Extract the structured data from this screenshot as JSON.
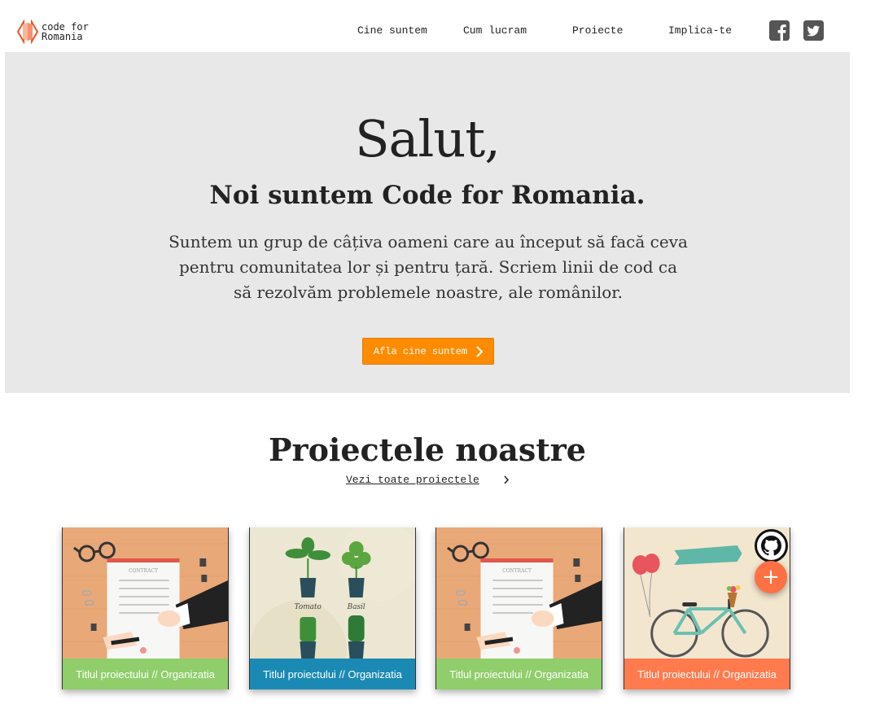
{
  "header": {
    "logo_line1": "code for",
    "logo_line2": "Romania",
    "nav": [
      {
        "label": "Cine suntem"
      },
      {
        "label": "Cum lucram"
      },
      {
        "label": "Proiecte"
      },
      {
        "label": "Implica-te"
      }
    ],
    "social": [
      "facebook-icon",
      "twitter-icon"
    ]
  },
  "hero": {
    "title": "Salut,",
    "subtitle": "Noi suntem Code for Romania.",
    "text": "Suntem un grup de câțiva oameni care au început să facă ceva pentru comunitatea lor și pentru țară. Scriem linii de cod ca să rezolvăm problemele noastre, ale românilor.",
    "cta_label": "Afla cine suntem"
  },
  "projects": {
    "title": "Proiectele noastre",
    "see_all": "Vezi toate proiectele",
    "cards": [
      {
        "label": "Titlul proiectului // Organizatia",
        "color": "#8fce6a",
        "image": "contract-illustration"
      },
      {
        "label": "Titlul proiectului // Organizatia",
        "color": "#1a8ab4",
        "image": "plants-illustration"
      },
      {
        "label": "Titlul proiectului // Organizatia",
        "color": "#8fce6a",
        "image": "contract-illustration"
      },
      {
        "label": "Titlul proiectului // Organizatia",
        "color": "#ff7a4d",
        "image": "bicycle-illustration"
      }
    ],
    "fab_label": "+"
  },
  "colors": {
    "accent": "#ff8c00",
    "hero_bg": "#e8e8e8"
  }
}
